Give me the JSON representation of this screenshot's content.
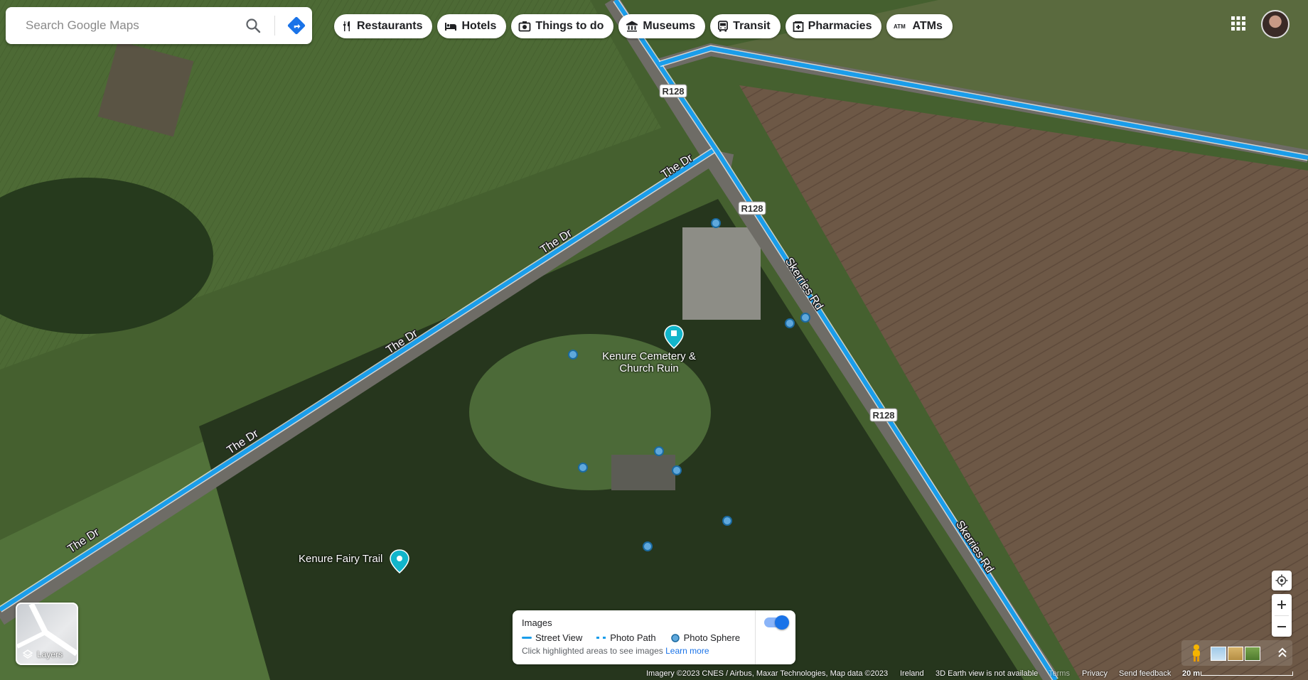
{
  "search": {
    "placeholder": "Search Google Maps"
  },
  "chips": [
    {
      "label": "Restaurants",
      "icon": "fork-knife-icon"
    },
    {
      "label": "Hotels",
      "icon": "bed-icon"
    },
    {
      "label": "Things to do",
      "icon": "camera-icon"
    },
    {
      "label": "Museums",
      "icon": "museum-icon"
    },
    {
      "label": "Transit",
      "icon": "bus-icon"
    },
    {
      "label": "Pharmacies",
      "icon": "pharmacy-icon"
    },
    {
      "label": "ATMs",
      "icon": "atm-icon"
    }
  ],
  "roads": {
    "r128": "R128",
    "the_dr": "The Dr",
    "skerries_rd": "Skerries Rd"
  },
  "places": {
    "cemetery": "Kenure Cemetery & Church Ruin",
    "fairy_trail": "Kenure Fairy Trail"
  },
  "layers": {
    "label": "Layers"
  },
  "legend": {
    "title": "Images",
    "street_view": "Street View",
    "photo_path": "Photo Path",
    "photo_sphere": "Photo Sphere",
    "hint": "Click highlighted areas to see images",
    "learn_more": "Learn more",
    "toggle_on": true
  },
  "footer": {
    "imagery": "Imagery ©2023 CNES / Airbus, Maxar Technologies, Map data ©2023",
    "country": "Ireland",
    "earth": "3D Earth view is not available",
    "terms": "Terms",
    "privacy": "Privacy",
    "feedback": "Send feedback",
    "scale": "20 m"
  },
  "colors": {
    "street_view_blue": "#1a9dea",
    "accent": "#1a73e8"
  }
}
